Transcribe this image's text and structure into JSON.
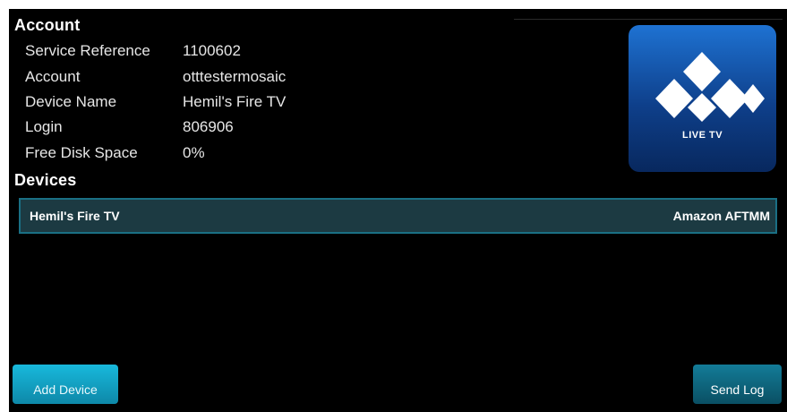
{
  "account": {
    "title": "Account",
    "rows": [
      {
        "label": "Service Reference",
        "value": "1100602"
      },
      {
        "label": "Account",
        "value": "otttestermosaic"
      },
      {
        "label": "Device Name",
        "value": "Hemil's Fire TV"
      },
      {
        "label": "Login",
        "value": "806906"
      },
      {
        "label": "Free Disk Space",
        "value": "0%"
      }
    ]
  },
  "devices": {
    "title": "Devices",
    "items": [
      {
        "name": "Hemil's Fire TV",
        "model": "Amazon AFTMM"
      }
    ]
  },
  "logo": {
    "text": "LIVE TV",
    "icon": "diamond-logo-icon",
    "color": "#1565c0"
  },
  "buttons": {
    "add_device": "Add Device",
    "send_log": "Send Log"
  },
  "colors": {
    "background": "#000000",
    "accent": "#14a7c9",
    "row_border": "#1a6f84"
  }
}
